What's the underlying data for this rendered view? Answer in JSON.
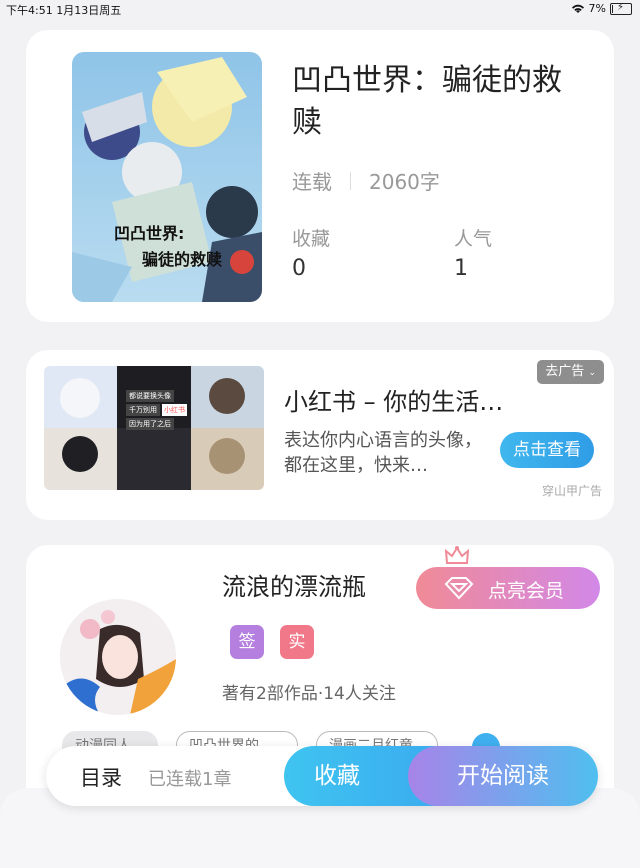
{
  "status_bar": {
    "time_date": "下午4:51  1月13日周五",
    "battery": "7%",
    "battery_level": 0.07
  },
  "book": {
    "cover_title_line1": "凹凸世界:",
    "cover_title_line2": "骗徒的救赎",
    "title": "凹凸世界：骗徒的救赎",
    "status": "连载",
    "word_count": "2060字",
    "favorites_label": "收藏",
    "favorites_value": "0",
    "popularity_label": "人气",
    "popularity_value": "1"
  },
  "ad": {
    "close_label": "去广告",
    "title": "小红书 – 你的生活…",
    "description": "表达你内心语言的头像，都在这里，快来…",
    "button_label": "点击查看",
    "source": "穿山甲广告",
    "image_captions": [
      "都说要换头像",
      "千万别用",
      "小红书",
      "因为用了之后"
    ]
  },
  "author": {
    "name": "流浪的漂流瓶",
    "vip_button": "点亮会员",
    "tags": [
      {
        "label": "签",
        "color": "#b57fe0"
      },
      {
        "label": "实",
        "color": "#f07888"
      }
    ],
    "info": "著有2部作品·14人关注",
    "chips": [
      "动漫同人",
      "凹凸世界的",
      "漫画二月红童"
    ]
  },
  "bottom_bar": {
    "toc_label": "目录",
    "chapters_label": "已连载1章",
    "favorite_button": "收藏",
    "read_button": "开始阅读"
  },
  "colors": {
    "accent_blue": "#3aa8ef",
    "vip_pink": "#f08a96",
    "vip_purple": "#d288e8"
  }
}
